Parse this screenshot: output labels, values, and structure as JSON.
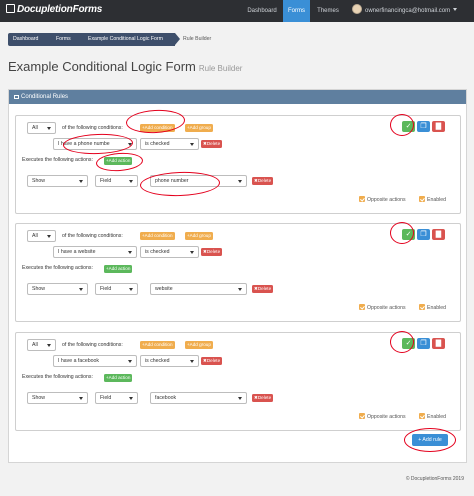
{
  "nav": {
    "brand": "DocupletionForms",
    "items": [
      {
        "label": "Dashboard",
        "active": false
      },
      {
        "label": "Forms",
        "active": true
      },
      {
        "label": "Themes",
        "active": false
      }
    ],
    "user": "ownerfinancingca@hotmail.com"
  },
  "breadcrumb": [
    "Dashboard",
    "Forms",
    "Example Conditional Logic Form",
    "Rule Builder"
  ],
  "page": {
    "title": "Example Conditional Logic Form",
    "subtitle": "Rule Builder"
  },
  "panel": {
    "title": "Conditional Rules"
  },
  "rules": [
    {
      "match": "All",
      "conditions_text": "of the following conditions:",
      "add_condition": "+Add condition",
      "add_group": "+Add group",
      "condition": {
        "field": "I have a phone numbe",
        "operator": "is checked",
        "delete": "Delete"
      },
      "executes_text": "Executes the following actions:",
      "add_action": "+Add action",
      "action": {
        "type": "Show",
        "target": "Field",
        "field": "phone number",
        "delete": "Delete"
      },
      "opposite": "Opposite actions",
      "enabled": "Enabled"
    },
    {
      "match": "All",
      "conditions_text": "of the following conditions:",
      "add_condition": "+Add condition",
      "add_group": "+Add group",
      "condition": {
        "field": "I have a website",
        "operator": "is checked",
        "delete": "Delete"
      },
      "executes_text": "Executes the following actions:",
      "add_action": "+Add action",
      "action": {
        "type": "Show",
        "target": "Field",
        "field": "website",
        "delete": "Delete"
      },
      "opposite": "Opposite actions",
      "enabled": "Enabled"
    },
    {
      "match": "All",
      "conditions_text": "of the following conditions:",
      "add_condition": "+Add condition",
      "add_group": "+Add group",
      "condition": {
        "field": "I have a facebook",
        "operator": "is checked",
        "delete": "Delete"
      },
      "executes_text": "Executes the following actions:",
      "add_action": "+Add action",
      "action": {
        "type": "Show",
        "target": "Field",
        "field": "facebook",
        "delete": "Delete"
      },
      "opposite": "Opposite actions",
      "enabled": "Enabled"
    }
  ],
  "add_rule": "+ Add rule",
  "footer": "© DocupletionForms 2019",
  "colors": {
    "navbar": "#2d2f33",
    "accent": "#3a8fd6",
    "panel_head": "#5f7f9f",
    "annotation": "#e4001d",
    "success": "#5cb85c",
    "danger": "#d9534f",
    "warning": "#f0ad4e"
  }
}
